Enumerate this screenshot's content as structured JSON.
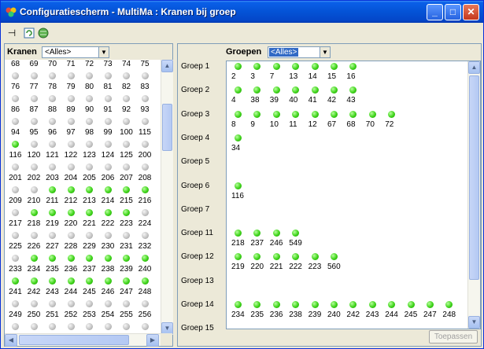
{
  "window": {
    "title": "Configuratiescherm - MultiMa : Kranen bij groep"
  },
  "title_buttons": {
    "minimize": "_",
    "maximize": "□",
    "close": "✕"
  },
  "toolbar_icons": [
    "pin-icon",
    "refresh-icon",
    "globe-icon"
  ],
  "kranen": {
    "label": "Kranen",
    "filter": "<Alles>",
    "rows": [
      {
        "numbers": [
          "68",
          "69",
          "70",
          "71",
          "72",
          "73",
          "74",
          "75"
        ],
        "states": [
          "s",
          "s",
          "s",
          "s",
          "s",
          "s",
          "s",
          "s"
        ]
      },
      {
        "numbers": [
          "76",
          "77",
          "78",
          "79",
          "80",
          "81",
          "82",
          "83"
        ],
        "states": [
          "s",
          "s",
          "s",
          "s",
          "s",
          "s",
          "s",
          "s"
        ]
      },
      {
        "numbers": [
          "86",
          "87",
          "88",
          "89",
          "90",
          "91",
          "92",
          "93"
        ],
        "states": [
          "s",
          "s",
          "s",
          "s",
          "s",
          "s",
          "s",
          "s"
        ]
      },
      {
        "numbers": [
          "94",
          "95",
          "96",
          "97",
          "98",
          "99",
          "100",
          "115"
        ],
        "states": [
          "g",
          "s",
          "s",
          "s",
          "s",
          "s",
          "s",
          "s"
        ]
      },
      {
        "numbers": [
          "116",
          "120",
          "121",
          "122",
          "123",
          "124",
          "125",
          "200"
        ],
        "states": [
          "s",
          "s",
          "s",
          "s",
          "s",
          "s",
          "s",
          "s"
        ]
      },
      {
        "numbers": [
          "201",
          "202",
          "203",
          "204",
          "205",
          "206",
          "207",
          "208"
        ],
        "states": [
          "s",
          "s",
          "g",
          "g",
          "g",
          "g",
          "g",
          "g"
        ]
      },
      {
        "numbers": [
          "209",
          "210",
          "211",
          "212",
          "213",
          "214",
          "215",
          "216"
        ],
        "states": [
          "s",
          "g",
          "g",
          "g",
          "g",
          "g",
          "g",
          "s"
        ]
      },
      {
        "numbers": [
          "217",
          "218",
          "219",
          "220",
          "221",
          "222",
          "223",
          "224"
        ],
        "states": [
          "s",
          "s",
          "s",
          "s",
          "s",
          "s",
          "s",
          "s"
        ]
      },
      {
        "numbers": [
          "225",
          "226",
          "227",
          "228",
          "229",
          "230",
          "231",
          "232"
        ],
        "states": [
          "s",
          "g",
          "g",
          "g",
          "g",
          "g",
          "g",
          "g"
        ]
      },
      {
        "numbers": [
          "233",
          "234",
          "235",
          "236",
          "237",
          "238",
          "239",
          "240"
        ],
        "states": [
          "g",
          "g",
          "g",
          "g",
          "g",
          "g",
          "g",
          "g"
        ]
      },
      {
        "numbers": [
          "241",
          "242",
          "243",
          "244",
          "245",
          "246",
          "247",
          "248"
        ],
        "states": [
          "s",
          "s",
          "s",
          "s",
          "s",
          "s",
          "s",
          "s"
        ]
      },
      {
        "numbers": [
          "249",
          "250",
          "251",
          "252",
          "253",
          "254",
          "255",
          "256"
        ],
        "states": [
          "s",
          "s",
          "s",
          "s",
          "s",
          "s",
          "s",
          "s"
        ]
      }
    ]
  },
  "groepen": {
    "label": "Groepen",
    "filter": "<Alles>",
    "groups": [
      {
        "name": "Groep 1",
        "items": [
          "2",
          "3",
          "7",
          "13",
          "14",
          "15",
          "16"
        ]
      },
      {
        "name": "Groep 2",
        "items": [
          "4",
          "38",
          "39",
          "40",
          "41",
          "42",
          "43"
        ]
      },
      {
        "name": "Groep 3",
        "items": [
          "8",
          "9",
          "10",
          "11",
          "12",
          "67",
          "68",
          "70",
          "72"
        ]
      },
      {
        "name": "Groep 4",
        "items": [
          "34"
        ]
      },
      {
        "name": "Groep 5",
        "items": []
      },
      {
        "name": "Groep 6",
        "items": [
          "116"
        ]
      },
      {
        "name": "Groep 7",
        "items": []
      },
      {
        "name": "Groep 11",
        "items": [
          "218",
          "237",
          "246",
          "549"
        ]
      },
      {
        "name": "Groep 12",
        "items": [
          "219",
          "220",
          "221",
          "222",
          "223",
          "560"
        ]
      },
      {
        "name": "Groep 13",
        "items": []
      },
      {
        "name": "Groep 14",
        "items": [
          "234",
          "235",
          "236",
          "238",
          "239",
          "240",
          "242",
          "243",
          "244",
          "245",
          "247",
          "248"
        ]
      },
      {
        "name": "Groep 15",
        "items": []
      }
    ]
  },
  "apply_button": "Toepassen",
  "colors": {
    "active": "#3fd41a",
    "inactive": "#c4c4c4",
    "title_bar": "#0453d6"
  }
}
